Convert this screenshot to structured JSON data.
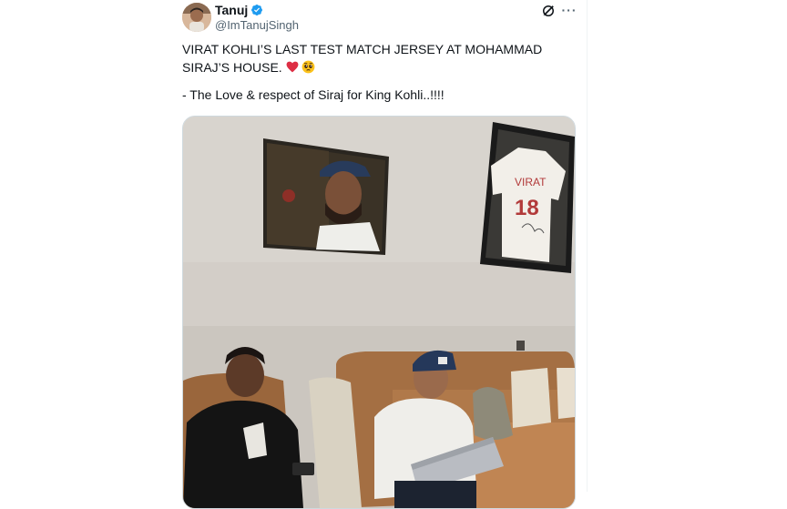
{
  "post": {
    "author": {
      "display_name": "Tanuj",
      "handle": "@ImTanujSingh",
      "verified": true,
      "avatar_icon": "user-avatar"
    },
    "text_line1": "VIRAT KOHLI’S LAST TEST MATCH JERSEY AT MOHAMMAD SIRAJ’S HOUSE.",
    "text_line2": "- The Love & respect of Siraj for King Kohli..!!!!",
    "emojis": [
      "red-heart",
      "pleading-face"
    ],
    "actions": {
      "grok_icon": "grok-icon",
      "more_label": "···"
    },
    "media": {
      "jersey_name": "VIRAT",
      "jersey_number": "18"
    }
  },
  "colors": {
    "verified_blue": "#1d9bf0",
    "secondary_text": "#536471",
    "wall": "#d1ccc6",
    "sofa": "#b07a4b"
  }
}
